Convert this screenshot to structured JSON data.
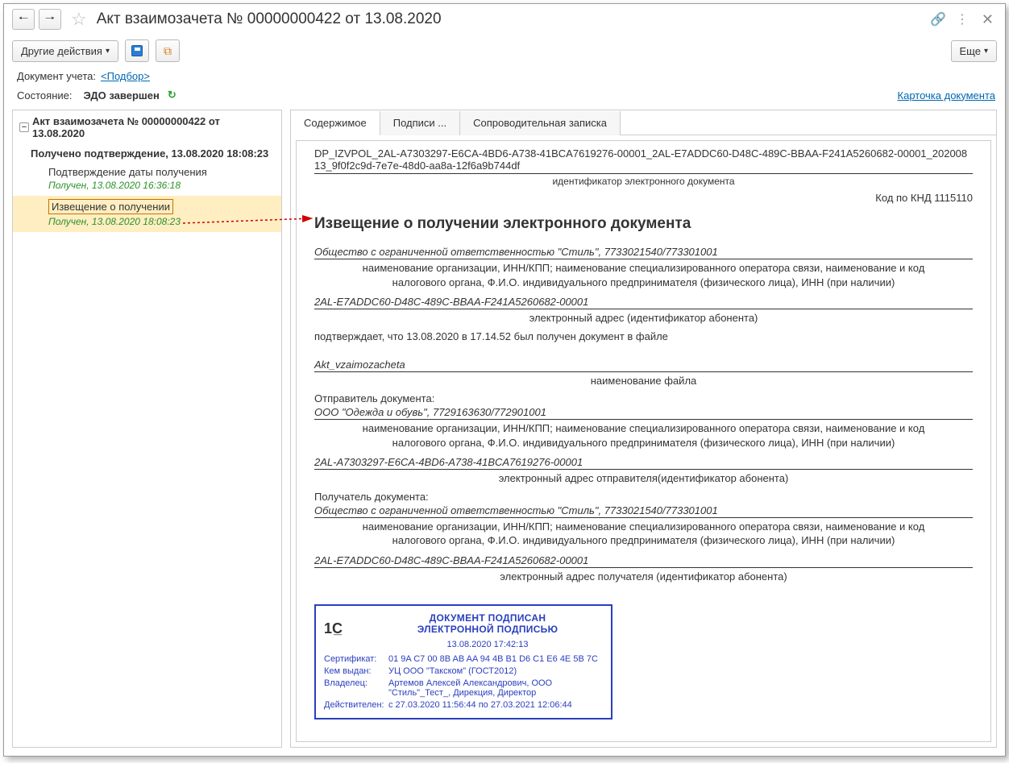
{
  "titlebar": {
    "title": "Акт взаимозачета № 00000000422 от 13.08.2020"
  },
  "toolbar": {
    "other_actions": "Другие действия",
    "more": "Еще"
  },
  "fields": {
    "doc_label": "Документ учета:",
    "pick_link": "<Подбор>",
    "state_label": "Состояние:",
    "state_value": "ЭДО завершен",
    "card_link": "Карточка документа"
  },
  "tree": {
    "root": "Акт взаимозачета № 00000000422 от 13.08.2020",
    "sub": "Получено подтверждение, 13.08.2020 18:08:23",
    "items": [
      {
        "label": "Подтверждение даты получения",
        "status": "Получен, 13.08.2020 16:36:18",
        "selected": false
      },
      {
        "label": "Извещение о получении",
        "status": "Получен, 13.08.2020 18:08:23",
        "selected": true
      }
    ]
  },
  "tabs": [
    "Содержимое",
    "Подписи ...",
    "Сопроводительная записка"
  ],
  "doc": {
    "file_id": "DP_IZVPOL_2AL-A7303297-E6CA-4BD6-A738-41BCA7619276-00001_2AL-E7ADDC60-D48C-489C-BBAA-F241A5260682-00001_20200813_9f0f2c9d-7e7e-48d0-aa8a-12f6a9b744df",
    "id_caption": "идентификатор электронного документа",
    "code_right": "Код по КНД 1115110",
    "title": "Извещение о получении электронного документа",
    "org1": "Общество с ограниченной ответственностью \"Стиль\", 7733021540/773301001",
    "org_caption": "наименование организации, ИНН/КПП; наименование специализированного оператора связи, наименование и код налогового органа, Ф.И.О. индивидуального предпринимателя (физического лица), ИНН (при наличии)",
    "addr1": "2AL-E7ADDC60-D48C-489C-BBAA-F241A5260682-00001",
    "addr1_caption": "электронный адрес (идентификатор абонента)",
    "confirm": "подтверждает, что 13.08.2020 в 17.14.52 был получен документ в файле",
    "file_name": "Akt_vzaimozacheta",
    "file_caption": "наименование файла",
    "sender_label": "Отправитель документа:",
    "sender_org": "ООО \"Одежда и обувь\", 7729163630/772901001",
    "sender_addr": "2AL-A7303297-E6CA-4BD6-A738-41BCA7619276-00001",
    "sender_addr_caption": "электронный адрес отправителя(идентификатор абонента)",
    "receiver_label": "Получатель документа:",
    "receiver_org": "Общество с ограниченной ответственностью \"Стиль\", 7733021540/773301001",
    "receiver_addr": "2AL-E7ADDC60-D48C-489C-BBAA-F241A5260682-00001",
    "receiver_addr_caption": "электронный адрес получателя (идентификатор абонента)"
  },
  "signature": {
    "head1": "ДОКУМЕНТ ПОДПИСАН",
    "head2": "ЭЛЕКТРОННОЙ ПОДПИСЬЮ",
    "date": "13.08.2020 17:42:13",
    "cert_label": "Сертификат:",
    "cert_value": "01 9A C7 00 8B AB AA 94 4B B1 D6 C1 E6 4E 5B 7C",
    "issuer_label": "Кем выдан:",
    "issuer_value": "УЦ ООО \"Такском\" (ГОСТ2012)",
    "owner_label": "Владелец:",
    "owner_value": "Артемов Алексей Александрович, ООО \"Стиль\"_Тест_, Дирекция, Директор",
    "valid_label": "Действителен:",
    "valid_value": "с 27.03.2020 11:56:44 по 27.03.2021 12:06:44"
  }
}
